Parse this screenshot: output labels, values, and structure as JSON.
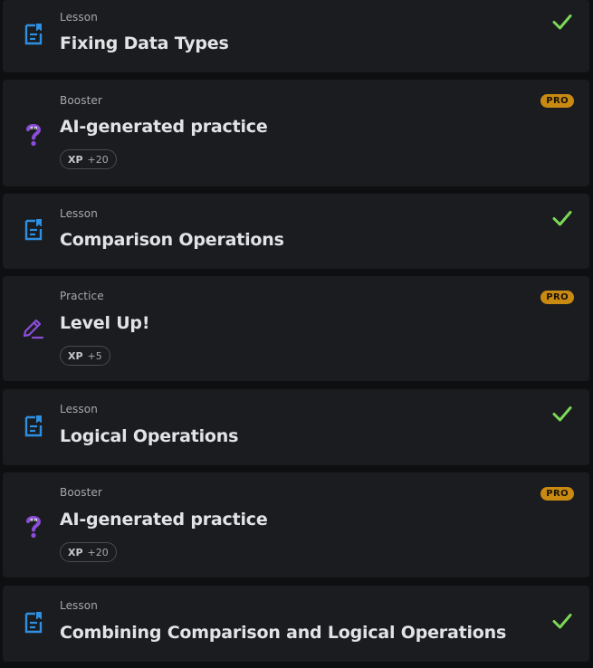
{
  "colors": {
    "background": "#0e0f11",
    "card": "#1b1c1f",
    "lesson_icon": "#2f8fe0",
    "booster_icon": "#8b4dd8",
    "practice_icon": "#8b4dd8",
    "check": "#7bd957",
    "pro_badge": "#c98a12"
  },
  "items": [
    {
      "type": "Lesson",
      "title": "Fixing Data Types",
      "icon": "document-icon",
      "status": "completed"
    },
    {
      "type": "Booster",
      "title": "AI-generated practice",
      "icon": "question-mark-icon",
      "badge": "PRO",
      "xp_label": "XP",
      "xp_value": "+20"
    },
    {
      "type": "Lesson",
      "title": "Comparison Operations",
      "icon": "document-icon",
      "status": "completed"
    },
    {
      "type": "Practice",
      "title": "Level Up!",
      "icon": "pencil-icon",
      "badge": "PRO",
      "xp_label": "XP",
      "xp_value": "+5"
    },
    {
      "type": "Lesson",
      "title": "Logical Operations",
      "icon": "document-icon",
      "status": "completed"
    },
    {
      "type": "Booster",
      "title": "AI-generated practice",
      "icon": "question-mark-icon",
      "badge": "PRO",
      "xp_label": "XP",
      "xp_value": "+20"
    },
    {
      "type": "Lesson",
      "title": "Combining Comparison and Logical Operations",
      "icon": "document-icon",
      "status": "completed"
    }
  ]
}
